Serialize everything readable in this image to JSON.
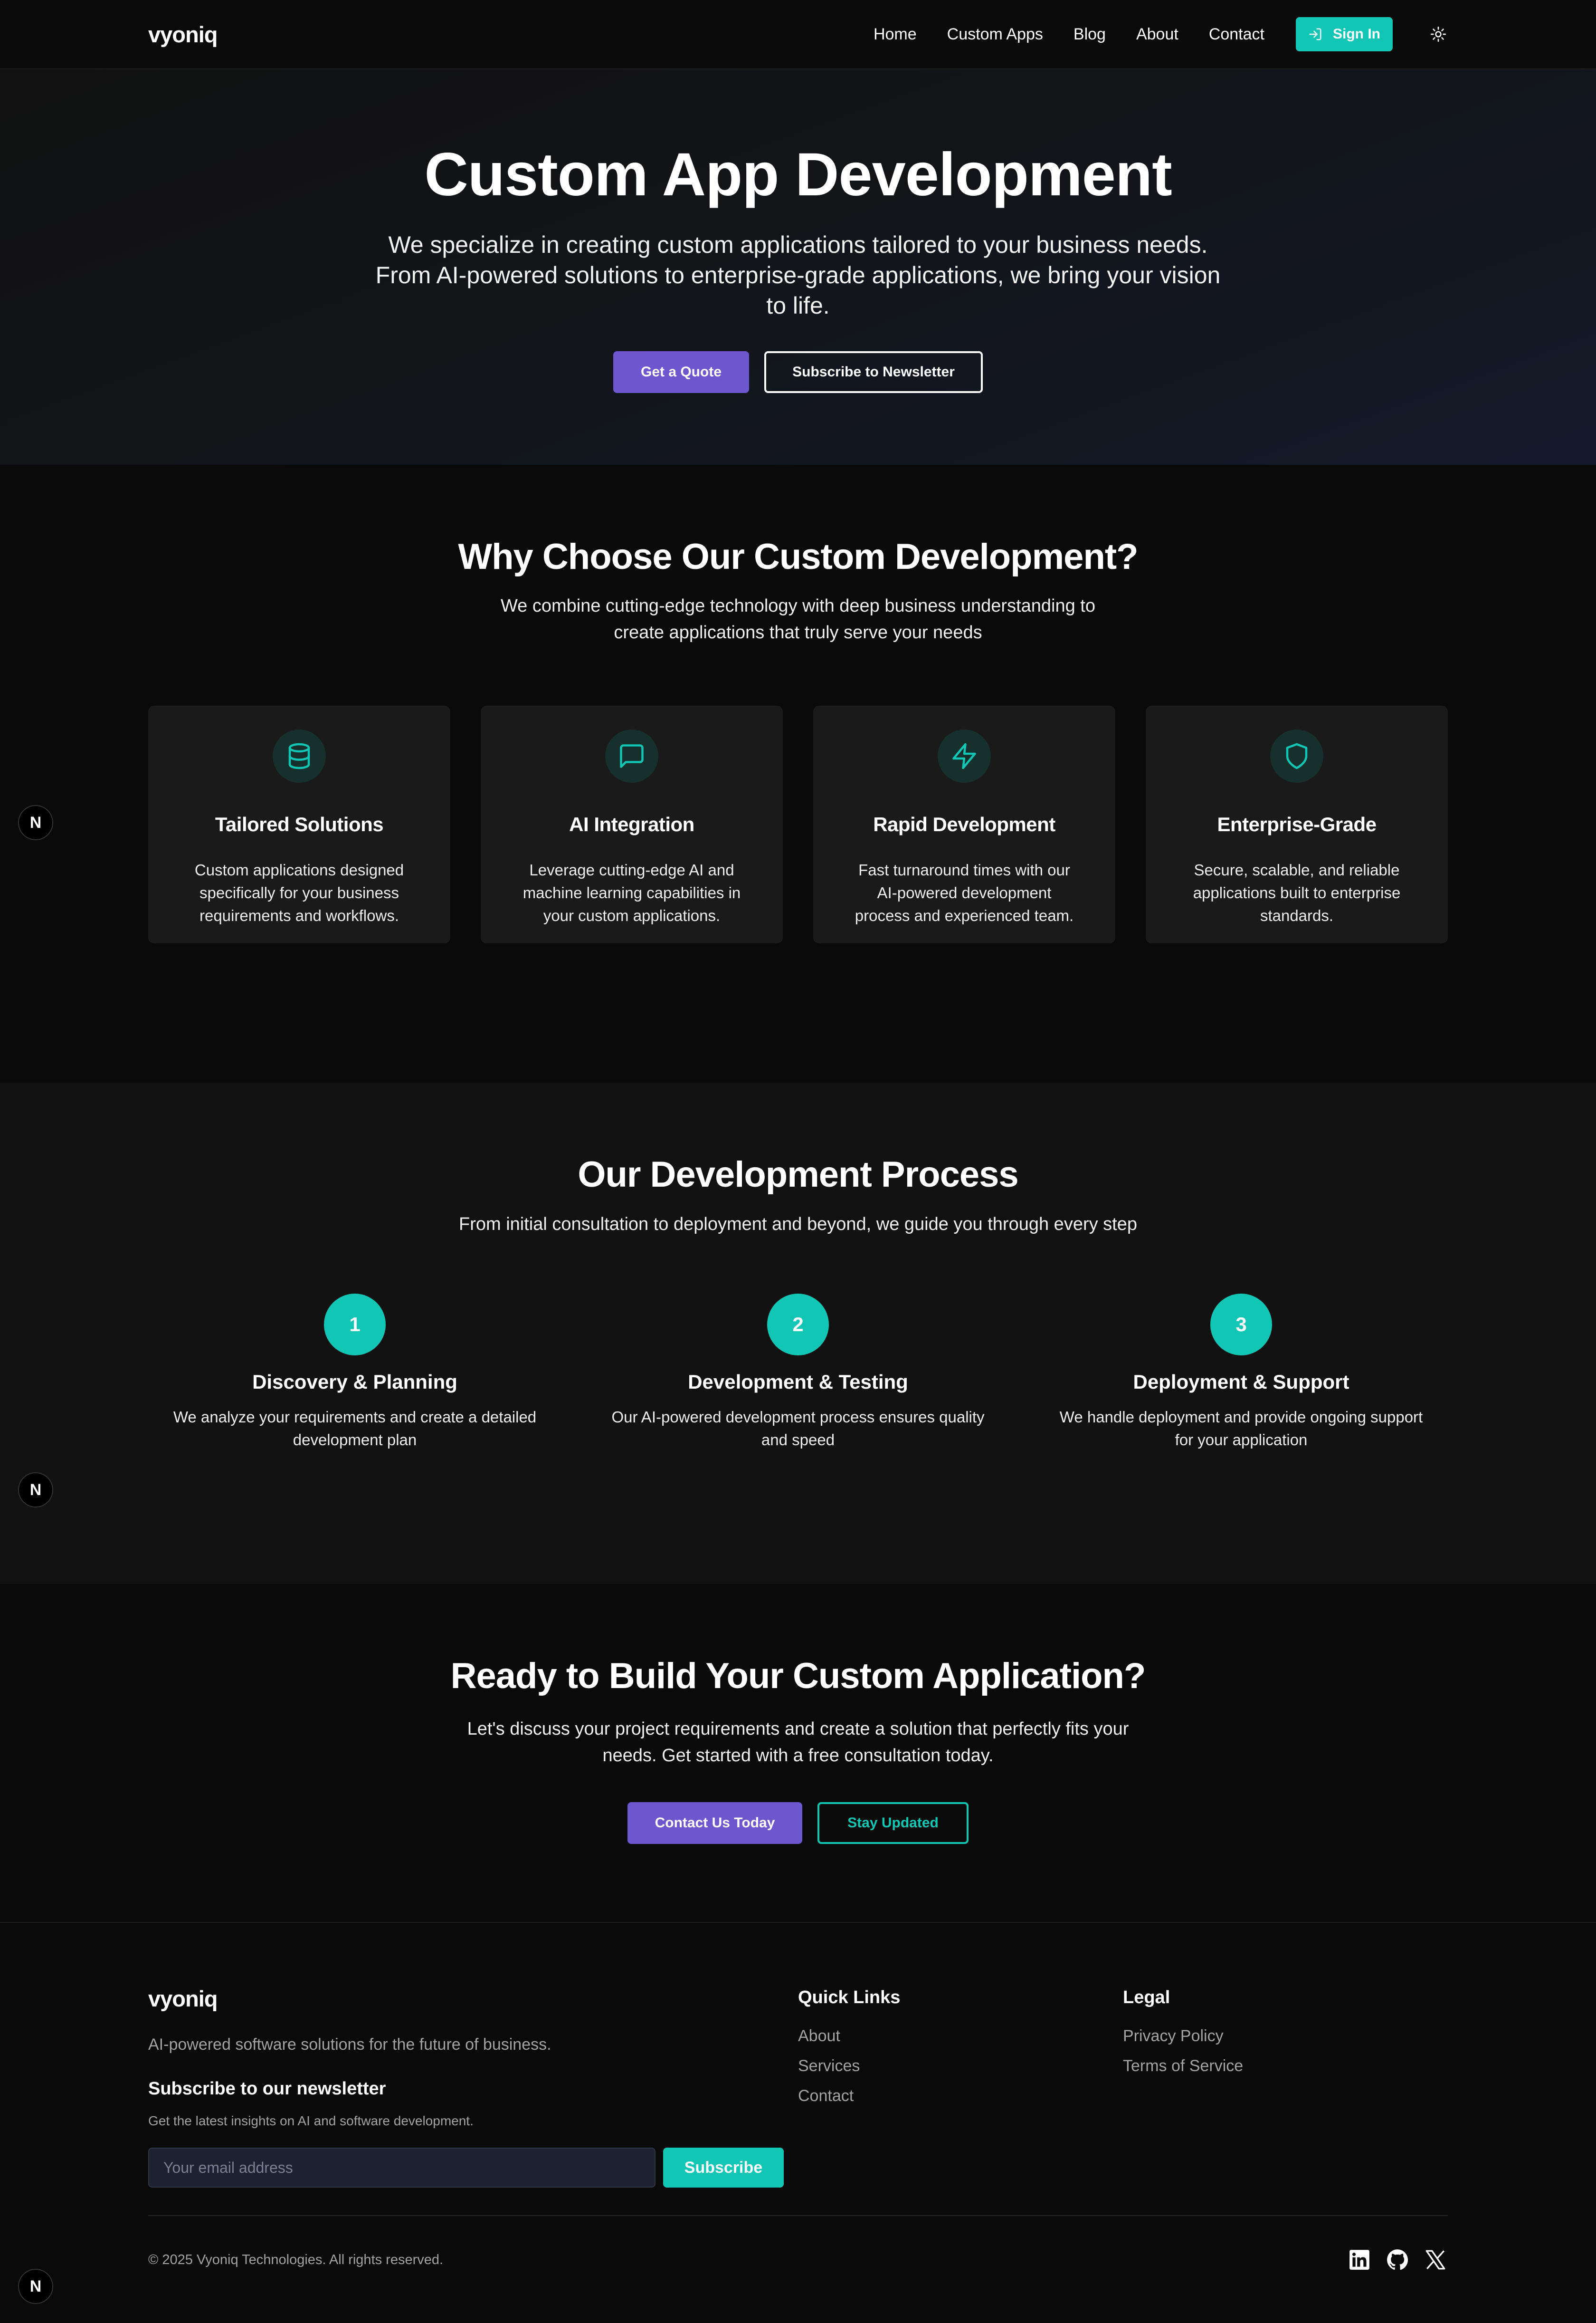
{
  "nav": {
    "logo": "vyoniq",
    "links": [
      "Home",
      "Custom Apps",
      "Blog",
      "About",
      "Contact"
    ],
    "signin": "Sign In",
    "theme_icon": "sun-icon"
  },
  "hero": {
    "title": "Custom App Development",
    "description": "We specialize in creating custom applications tailored to your business needs. From AI-powered solutions to enterprise-grade applications, we bring your vision to life.",
    "primary_button": "Get a Quote",
    "secondary_button": "Subscribe to Newsletter"
  },
  "why": {
    "title": "Why Choose Our Custom Development?",
    "subtitle": "We combine cutting-edge technology with deep business understanding to create applications that truly serve your needs",
    "cards": [
      {
        "icon": "database-icon",
        "title": "Tailored Solutions",
        "text": "Custom applications designed specifically for your business requirements and workflows."
      },
      {
        "icon": "chat-icon",
        "title": "AI Integration",
        "text": "Leverage cutting-edge AI and machine learning capabilities in your custom applications."
      },
      {
        "icon": "lightning-icon",
        "title": "Rapid Development",
        "text": "Fast turnaround times with our AI-powered development process and experienced team."
      },
      {
        "icon": "shield-icon",
        "title": "Enterprise-Grade",
        "text": "Secure, scalable, and reliable applications built to enterprise standards."
      }
    ]
  },
  "process": {
    "title": "Our Development Process",
    "subtitle": "From initial consultation to deployment and beyond, we guide you through every step",
    "steps": [
      {
        "number": "1",
        "title": "Discovery & Planning",
        "text": "We analyze your requirements and create a detailed development plan"
      },
      {
        "number": "2",
        "title": "Development & Testing",
        "text": "Our AI-powered development process ensures quality and speed"
      },
      {
        "number": "3",
        "title": "Deployment & Support",
        "text": "We handle deployment and provide ongoing support for your application"
      }
    ]
  },
  "cta": {
    "title": "Ready to Build Your Custom Application?",
    "text": "Let's discuss your project requirements and create a solution that perfectly fits your needs. Get started with a free consultation today.",
    "primary_button": "Contact Us Today",
    "secondary_button": "Stay Updated"
  },
  "footer": {
    "logo": "vyoniq",
    "tagline": "AI-powered software solutions for the future of business.",
    "newsletter_title": "Subscribe to our newsletter",
    "newsletter_desc": "Get the latest insights on AI and software development.",
    "email_placeholder": "Your email address",
    "subscribe_button": "Subscribe",
    "quick_links_title": "Quick Links",
    "quick_links": [
      "About",
      "Services",
      "Contact"
    ],
    "legal_title": "Legal",
    "legal_links": [
      "Privacy Policy",
      "Terms of Service"
    ],
    "copyright": "© 2025 Vyoniq Technologies. All rights reserved.",
    "socials": [
      "linkedin-icon",
      "github-icon",
      "x-icon"
    ]
  },
  "badge": {
    "letter": "N"
  },
  "colors": {
    "accent_teal": "#12c6b6",
    "accent_purple": "#6e56cf",
    "background": "#0a0a0a"
  }
}
